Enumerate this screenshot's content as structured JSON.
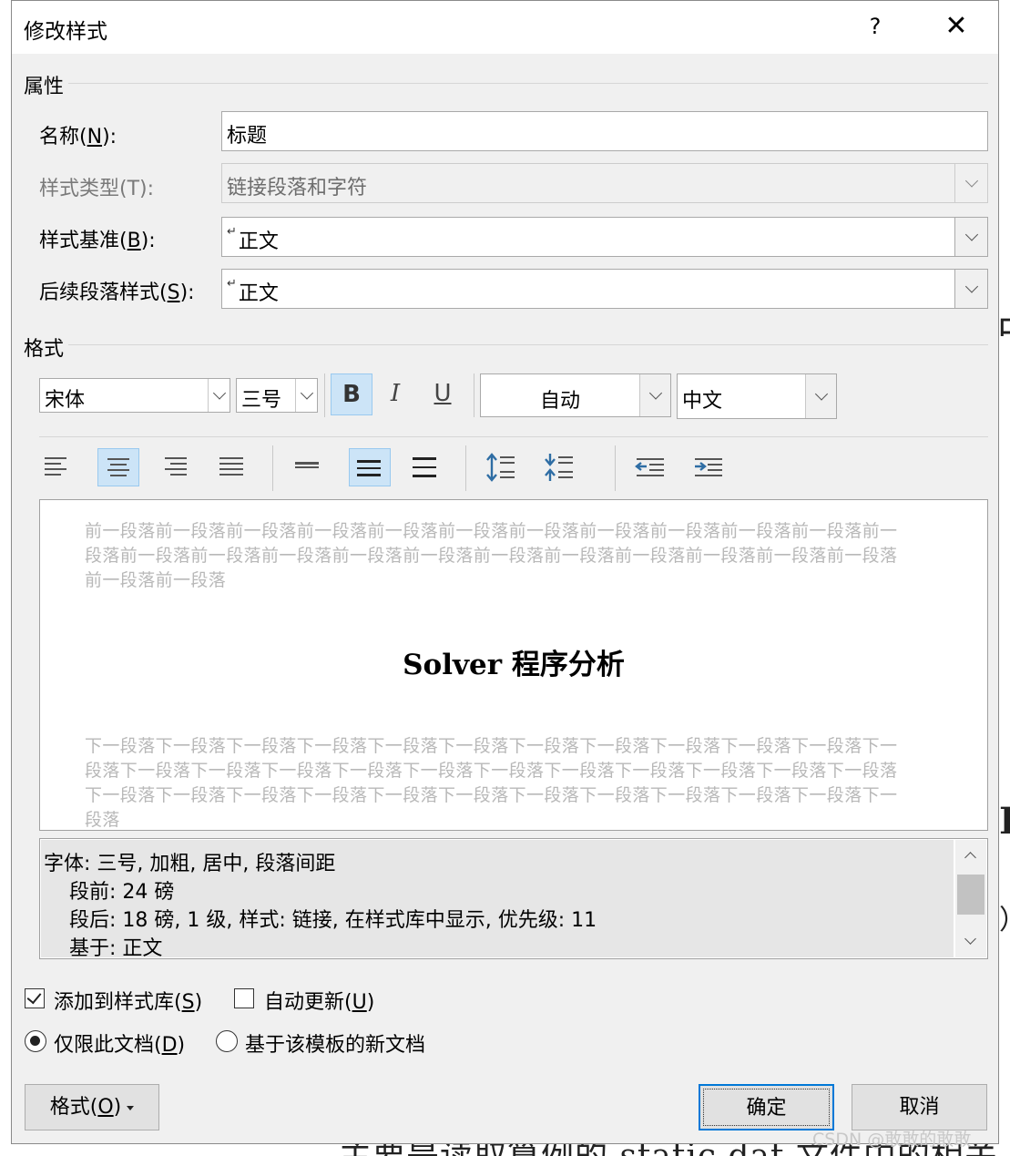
{
  "dialog": {
    "title": "修改样式",
    "help_label": "?",
    "close_label": "✕"
  },
  "properties": {
    "section_label": "属性",
    "name_label_pre": "名称(",
    "name_label_key": "N",
    "name_label_post": "):",
    "name_value": "标题",
    "type_label": "样式类型(T):",
    "type_value": "链接段落和字符",
    "based_label_pre": "样式基准(",
    "based_label_key": "B",
    "based_label_post": "):",
    "based_value": "正文",
    "next_label_pre": "后续段落样式(",
    "next_label_key": "S",
    "next_label_post": "):",
    "next_value": "正文",
    "return_mark": "↵"
  },
  "format": {
    "section_label": "格式",
    "font_name": "宋体",
    "font_size": "三号",
    "bold_label": "B",
    "italic_label": "I",
    "underline_label": "U",
    "color_value": "自动",
    "script_value": "中文",
    "active_bold": true,
    "active_alignment": "center",
    "active_spacing": "1.5"
  },
  "preview": {
    "before_text": "前一段落前一段落前一段落前一段落前一段落前一段落前一段落前一段落前一段落前一段落前一段落前一段落前一段落前一段落前一段落前一段落前一段落前一段落前一段落前一段落前一段落前一段落前一段落前一段落前一段落",
    "title": "Solver 程序分析",
    "after_text": "下一段落下一段落下一段落下一段落下一段落下一段落下一段落下一段落下一段落下一段落下一段落下一段落下一段落下一段落下一段落下一段落下一段落下一段落下一段落下一段落下一段落下一段落下一段落下一段落下一段落下一段落下一段落下一段落下一段落下一段落下一段落下一段落下一段落下一段落下一段落"
  },
  "description": {
    "lines": [
      "字体: 三号, 加粗, 居中, 段落间距",
      "段前: 24 磅",
      "段后: 18 磅, 1 级, 样式: 链接, 在样式库中显示, 优先级: 11",
      "基于: 正文"
    ]
  },
  "options": {
    "add_to_gallery_pre": "添加到样式库(",
    "add_to_gallery_key": "S",
    "add_to_gallery_post": ")",
    "add_to_gallery_checked": true,
    "auto_update_pre": "自动更新(",
    "auto_update_key": "U",
    "auto_update_post": ")",
    "auto_update_checked": false,
    "only_doc_pre": "仅限此文档(",
    "only_doc_key": "D",
    "only_doc_post": ")",
    "new_docs_label": "基于该模板的新文档",
    "selected": "only_doc"
  },
  "buttons": {
    "format_pre": "格式(",
    "format_key": "O",
    "format_post": ")",
    "ok": "确定",
    "cancel": "取消"
  },
  "background": {
    "bottom_text": "主要是读取算例的 static.dat 文件中的相关",
    "edge_char_1": "中",
    "edge_char_2": "D",
    "edge_char_3": "）",
    "watermark": "CSDN @敢敢的敢敢"
  }
}
